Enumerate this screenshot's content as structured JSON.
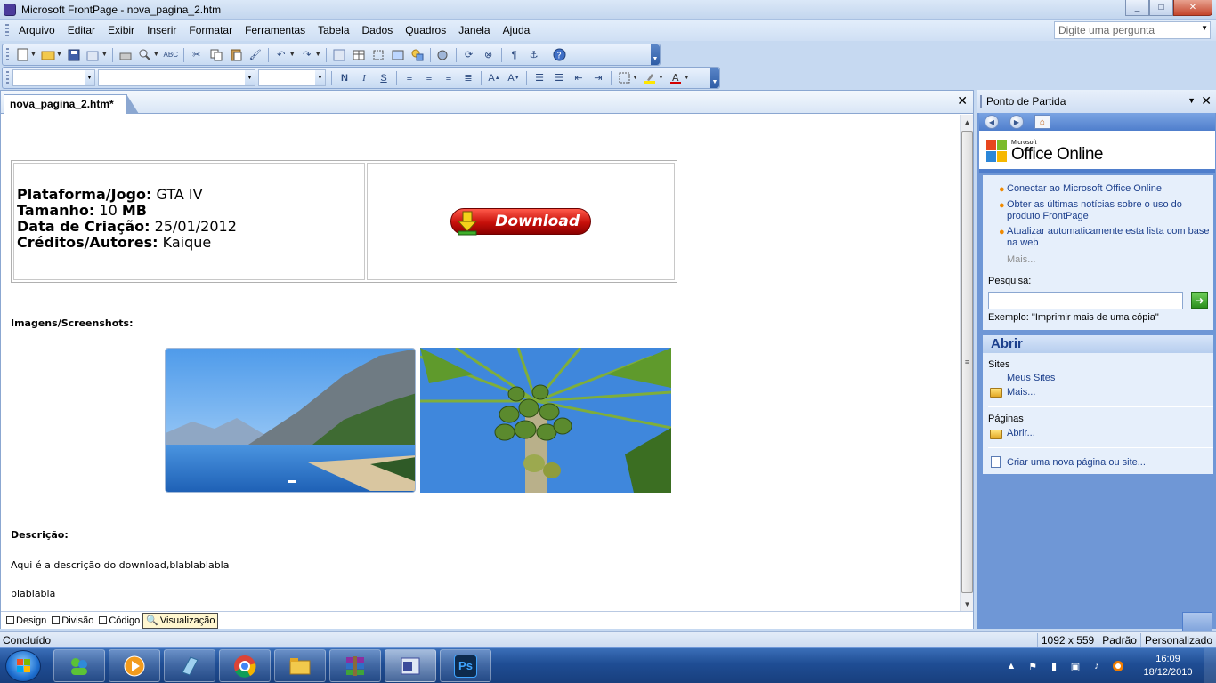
{
  "window": {
    "title": "Microsoft FrontPage - nova_pagina_2.htm",
    "minimize": "_",
    "maximize": "□",
    "close": "✕"
  },
  "menu": {
    "items": [
      "Arquivo",
      "Editar",
      "Exibir",
      "Inserir",
      "Formatar",
      "Ferramentas",
      "Tabela",
      "Dados",
      "Quadros",
      "Janela",
      "Ajuda"
    ],
    "help_placeholder": "Digite uma pergunta"
  },
  "formatting": {
    "bold": "N",
    "italic": "I",
    "underline": "S"
  },
  "document": {
    "tab_name": "nova_pagina_2.htm*",
    "close": "✕",
    "info": {
      "platform_label": "Plataforma/Jogo:",
      "platform_value": " GTA IV",
      "size_label": "Tamanho:",
      "size_value": " 10 ",
      "size_unit": "MB",
      "date_label": "Data de Criação:",
      "date_value": " 25/01/2012",
      "credits_label": "Créditos/Autores:",
      "credits_value": " Kaique"
    },
    "download_button": "Download",
    "images_heading": "Imagens/Screenshots:",
    "description_heading": "Descrição:",
    "description_line1": "Aqui é a descrição do download,blablablabla",
    "description_line2": "blablabla"
  },
  "view_tabs": [
    "Design",
    "Divisão",
    "Código",
    "Visualização"
  ],
  "task_pane": {
    "title": "Ponto de Partida",
    "logo_small": "Microsoft",
    "logo_text": "Office Online",
    "links": [
      "Conectar ao Microsoft Office Online",
      "Obter as últimas notícias sobre o uso do produto FrontPage",
      "Atualizar automaticamente esta lista com base na web"
    ],
    "more": "Mais...",
    "search_label": "Pesquisa:",
    "search_value": "",
    "example": "Exemplo:  \"Imprimir mais de uma cópia\"",
    "open_heading": "Abrir",
    "sites_label": "Sites",
    "my_sites": "Meus Sites",
    "sites_more": "Mais...",
    "pages_label": "Páginas",
    "pages_open": "Abrir...",
    "create_new": "Criar uma nova página ou site..."
  },
  "status": {
    "left": "Concluído",
    "dimensions": "1092 x 559",
    "mode": "Padrão",
    "custom": "Personalizado"
  },
  "clock": {
    "time": "16:09",
    "date": "18/12/2010"
  },
  "taskbar_apps": [
    "windows-live-messenger",
    "windows-media-player",
    "notepad",
    "google-chrome",
    "windows-explorer",
    "winrar",
    "frontpage",
    "photoshop"
  ],
  "photoshop_label": "Ps",
  "colors": {
    "accent": "#4f7ecc",
    "link": "#1c3f8c",
    "download": "#c7100a",
    "taskbar": "#1f4d94"
  }
}
